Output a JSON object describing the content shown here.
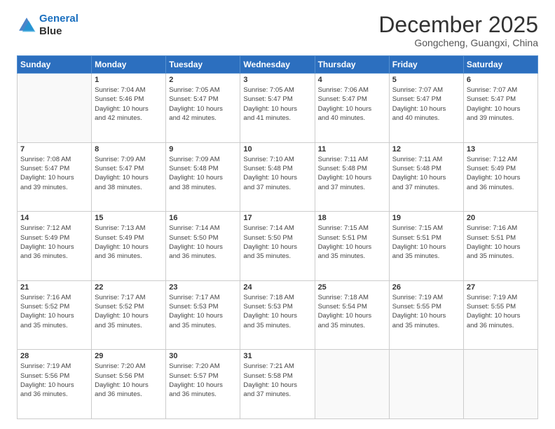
{
  "header": {
    "logo_line1": "General",
    "logo_line2": "Blue",
    "month": "December 2025",
    "location": "Gongcheng, Guangxi, China"
  },
  "weekdays": [
    "Sunday",
    "Monday",
    "Tuesday",
    "Wednesday",
    "Thursday",
    "Friday",
    "Saturday"
  ],
  "weeks": [
    [
      {
        "day": "",
        "info": ""
      },
      {
        "day": "1",
        "info": "Sunrise: 7:04 AM\nSunset: 5:46 PM\nDaylight: 10 hours\nand 42 minutes."
      },
      {
        "day": "2",
        "info": "Sunrise: 7:05 AM\nSunset: 5:47 PM\nDaylight: 10 hours\nand 42 minutes."
      },
      {
        "day": "3",
        "info": "Sunrise: 7:05 AM\nSunset: 5:47 PM\nDaylight: 10 hours\nand 41 minutes."
      },
      {
        "day": "4",
        "info": "Sunrise: 7:06 AM\nSunset: 5:47 PM\nDaylight: 10 hours\nand 40 minutes."
      },
      {
        "day": "5",
        "info": "Sunrise: 7:07 AM\nSunset: 5:47 PM\nDaylight: 10 hours\nand 40 minutes."
      },
      {
        "day": "6",
        "info": "Sunrise: 7:07 AM\nSunset: 5:47 PM\nDaylight: 10 hours\nand 39 minutes."
      }
    ],
    [
      {
        "day": "7",
        "info": "Sunrise: 7:08 AM\nSunset: 5:47 PM\nDaylight: 10 hours\nand 39 minutes."
      },
      {
        "day": "8",
        "info": "Sunrise: 7:09 AM\nSunset: 5:47 PM\nDaylight: 10 hours\nand 38 minutes."
      },
      {
        "day": "9",
        "info": "Sunrise: 7:09 AM\nSunset: 5:48 PM\nDaylight: 10 hours\nand 38 minutes."
      },
      {
        "day": "10",
        "info": "Sunrise: 7:10 AM\nSunset: 5:48 PM\nDaylight: 10 hours\nand 37 minutes."
      },
      {
        "day": "11",
        "info": "Sunrise: 7:11 AM\nSunset: 5:48 PM\nDaylight: 10 hours\nand 37 minutes."
      },
      {
        "day": "12",
        "info": "Sunrise: 7:11 AM\nSunset: 5:48 PM\nDaylight: 10 hours\nand 37 minutes."
      },
      {
        "day": "13",
        "info": "Sunrise: 7:12 AM\nSunset: 5:49 PM\nDaylight: 10 hours\nand 36 minutes."
      }
    ],
    [
      {
        "day": "14",
        "info": "Sunrise: 7:12 AM\nSunset: 5:49 PM\nDaylight: 10 hours\nand 36 minutes."
      },
      {
        "day": "15",
        "info": "Sunrise: 7:13 AM\nSunset: 5:49 PM\nDaylight: 10 hours\nand 36 minutes."
      },
      {
        "day": "16",
        "info": "Sunrise: 7:14 AM\nSunset: 5:50 PM\nDaylight: 10 hours\nand 36 minutes."
      },
      {
        "day": "17",
        "info": "Sunrise: 7:14 AM\nSunset: 5:50 PM\nDaylight: 10 hours\nand 35 minutes."
      },
      {
        "day": "18",
        "info": "Sunrise: 7:15 AM\nSunset: 5:51 PM\nDaylight: 10 hours\nand 35 minutes."
      },
      {
        "day": "19",
        "info": "Sunrise: 7:15 AM\nSunset: 5:51 PM\nDaylight: 10 hours\nand 35 minutes."
      },
      {
        "day": "20",
        "info": "Sunrise: 7:16 AM\nSunset: 5:51 PM\nDaylight: 10 hours\nand 35 minutes."
      }
    ],
    [
      {
        "day": "21",
        "info": "Sunrise: 7:16 AM\nSunset: 5:52 PM\nDaylight: 10 hours\nand 35 minutes."
      },
      {
        "day": "22",
        "info": "Sunrise: 7:17 AM\nSunset: 5:52 PM\nDaylight: 10 hours\nand 35 minutes."
      },
      {
        "day": "23",
        "info": "Sunrise: 7:17 AM\nSunset: 5:53 PM\nDaylight: 10 hours\nand 35 minutes."
      },
      {
        "day": "24",
        "info": "Sunrise: 7:18 AM\nSunset: 5:53 PM\nDaylight: 10 hours\nand 35 minutes."
      },
      {
        "day": "25",
        "info": "Sunrise: 7:18 AM\nSunset: 5:54 PM\nDaylight: 10 hours\nand 35 minutes."
      },
      {
        "day": "26",
        "info": "Sunrise: 7:19 AM\nSunset: 5:55 PM\nDaylight: 10 hours\nand 35 minutes."
      },
      {
        "day": "27",
        "info": "Sunrise: 7:19 AM\nSunset: 5:55 PM\nDaylight: 10 hours\nand 36 minutes."
      }
    ],
    [
      {
        "day": "28",
        "info": "Sunrise: 7:19 AM\nSunset: 5:56 PM\nDaylight: 10 hours\nand 36 minutes."
      },
      {
        "day": "29",
        "info": "Sunrise: 7:20 AM\nSunset: 5:56 PM\nDaylight: 10 hours\nand 36 minutes."
      },
      {
        "day": "30",
        "info": "Sunrise: 7:20 AM\nSunset: 5:57 PM\nDaylight: 10 hours\nand 36 minutes."
      },
      {
        "day": "31",
        "info": "Sunrise: 7:21 AM\nSunset: 5:58 PM\nDaylight: 10 hours\nand 37 minutes."
      },
      {
        "day": "",
        "info": ""
      },
      {
        "day": "",
        "info": ""
      },
      {
        "day": "",
        "info": ""
      }
    ]
  ]
}
